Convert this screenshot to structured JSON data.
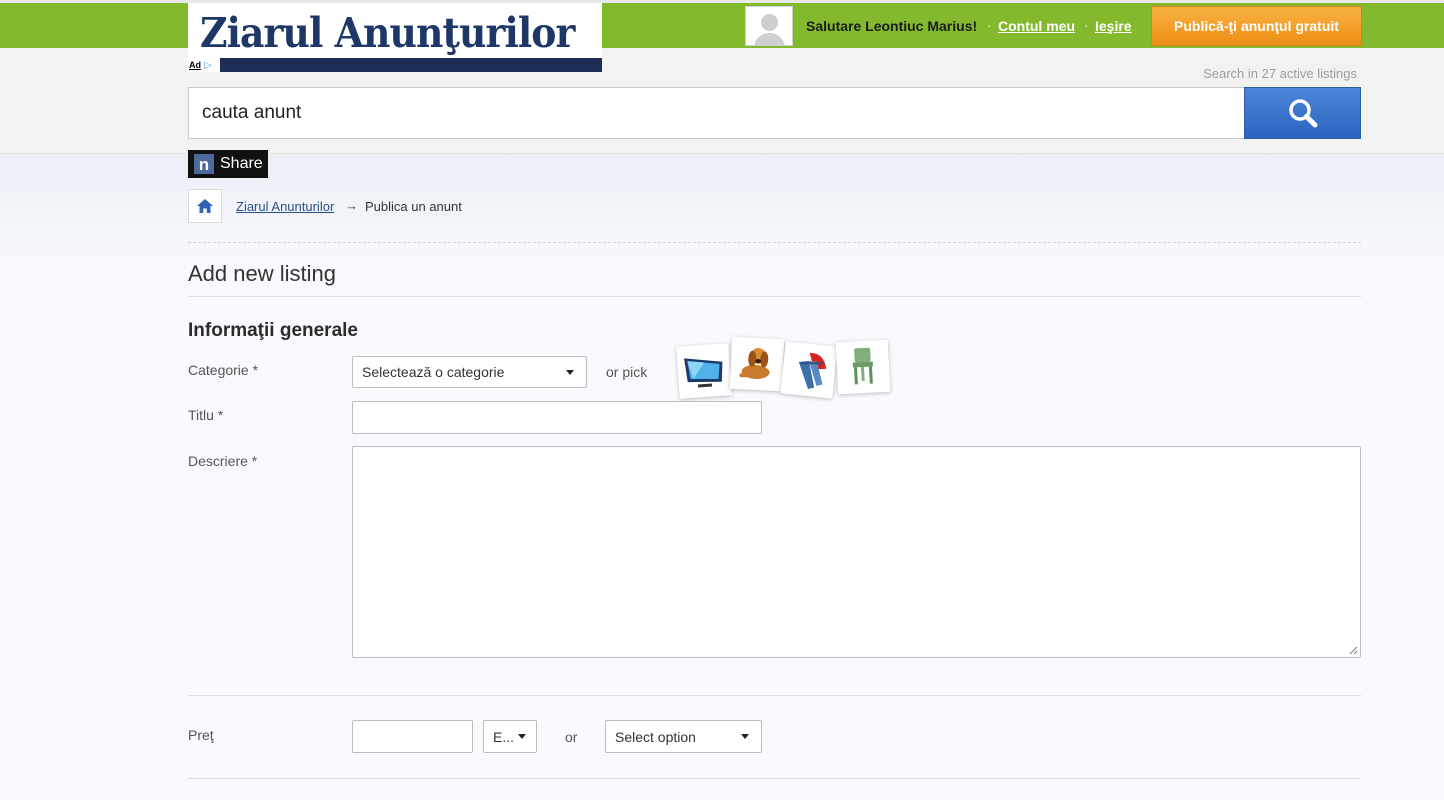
{
  "header": {
    "logo_text": "Ziarul Anunţurilor",
    "ad_label": "Ad",
    "greeting": "Salutare Leontiuc Marius!",
    "separator": "·",
    "account_link": "Contul meu",
    "logout_link": "Ieşire",
    "publish_button": "Publică-ţi anunţul gratuit"
  },
  "search": {
    "hint": "Search in 27 active listings",
    "value": "cauta anunt"
  },
  "share": {
    "logo_letter": "n",
    "label": "Share"
  },
  "breadcrumb": {
    "home_link": "Ziarul Anunturilor",
    "arrow": "→",
    "current": "Publica un anunt"
  },
  "page": {
    "title": "Add new listing",
    "section_title": "Informaţii generale"
  },
  "form": {
    "category_label": "Categorie *",
    "category_select": "Selectează o categorie",
    "or_pick": "or pick",
    "pick_icons": [
      "tv-icon",
      "dog-icon",
      "clothing-icon",
      "chair-icon"
    ],
    "title_label": "Titlu *",
    "title_value": "",
    "description_label": "Descriere *",
    "description_value": "",
    "price_label": "Preţ",
    "price_value": "",
    "currency_select": "E...",
    "or_text": "or",
    "price_option_select": "Select option"
  },
  "colors": {
    "topbar": "#82b92d",
    "publish_button": "#f5a02b",
    "search_button": "#3a74cf",
    "logo_text": "#1e3766",
    "link": "#2a4f87"
  }
}
